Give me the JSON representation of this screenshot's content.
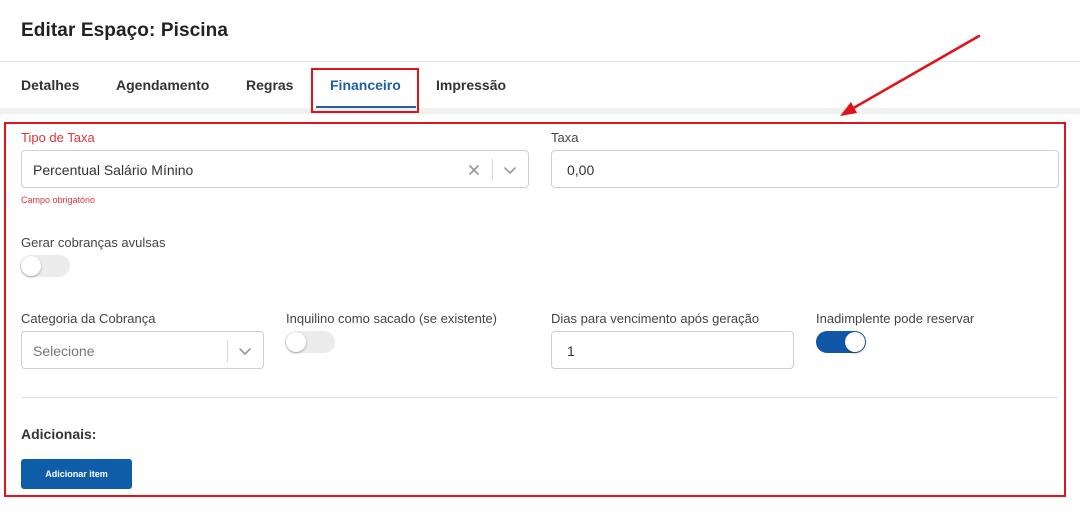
{
  "modal": {
    "title": "Editar Espaço: Piscina"
  },
  "tabs": [
    {
      "label": "Detalhes"
    },
    {
      "label": "Agendamento"
    },
    {
      "label": "Regras"
    },
    {
      "label": "Financeiro",
      "active": true
    },
    {
      "label": "Impressão"
    }
  ],
  "form": {
    "tipo_taxa": {
      "label": "Tipo de Taxa",
      "value": "Percentual Salário Mínino",
      "error": "Campo obrigatório"
    },
    "taxa": {
      "label": "Taxa",
      "value": "0,00"
    },
    "gerar_cobrancas": {
      "label": "Gerar cobranças avulsas",
      "checked": false
    },
    "categoria": {
      "label": "Categoria da Cobrança",
      "placeholder": "Selecione"
    },
    "inquilino_sacado": {
      "label": "Inquilino como sacado (se existente)",
      "checked": false
    },
    "dias_vencimento": {
      "label": "Dias para vencimento após geração",
      "value": "1"
    },
    "inadimplente": {
      "label": "Inadimplente pode reservar",
      "checked": true
    }
  },
  "adicionais": {
    "title": "Adicionais:",
    "add_button_label": "Adicionar item"
  },
  "icons": {
    "clear": "clear-icon",
    "dropdown": "chevron-down-icon"
  },
  "colors": {
    "accent": "#1f5fa8",
    "toggle_on": "#1157a8",
    "error": "#e2363a",
    "annotation": "#e0131b"
  }
}
